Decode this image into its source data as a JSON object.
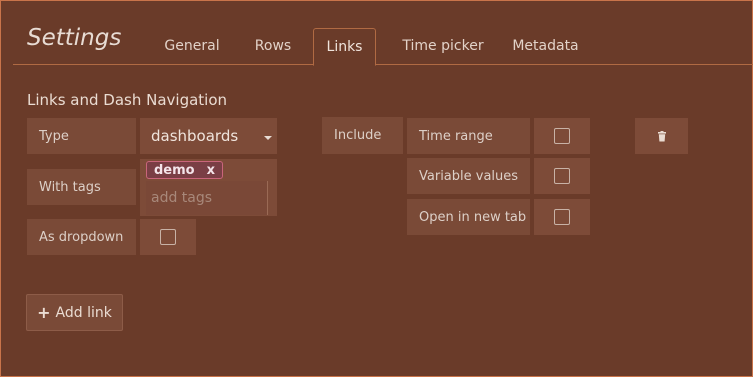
{
  "header": {
    "title": "Settings",
    "tabs": [
      {
        "label": "General",
        "active": false
      },
      {
        "label": "Rows",
        "active": false
      },
      {
        "label": "Links",
        "active": true
      },
      {
        "label": "Time picker",
        "active": false
      },
      {
        "label": "Metadata",
        "active": false
      }
    ]
  },
  "links_section": {
    "title": "Links and Dash Navigation",
    "type_label": "Type",
    "type_value": "dashboards",
    "with_tags_label": "With tags",
    "tags": [
      "demo"
    ],
    "tag_remove_symbol": "x",
    "tag_input_placeholder": "add tags",
    "as_dropdown_label": "As dropdown",
    "as_dropdown_checked": false,
    "include_label": "Include",
    "include_options": [
      {
        "label": "Time range",
        "checked": false
      },
      {
        "label": "Variable values",
        "checked": false
      },
      {
        "label": "Open in new tab",
        "checked": false
      }
    ],
    "add_link_label": "Add link"
  },
  "icons": {
    "trash": "trash-icon",
    "plus": "plus-icon",
    "caret": "caret-down-icon"
  },
  "colors": {
    "background": "#6a3b29",
    "border_accent": "#c9744a",
    "panel": "#7d4b38",
    "tag": "#7a3e45"
  }
}
